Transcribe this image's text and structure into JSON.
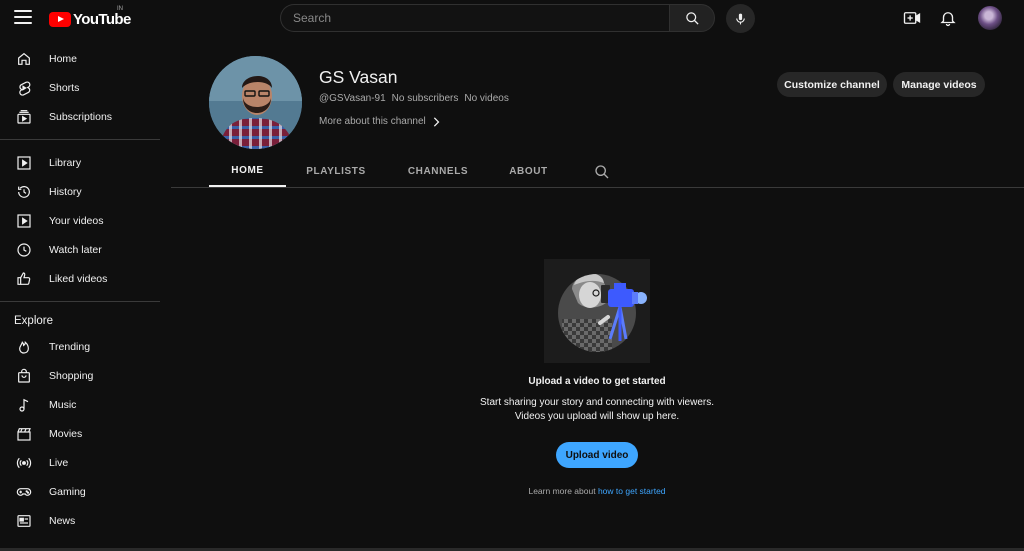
{
  "topbar": {
    "logo_text": "YouTube",
    "country_code": "IN",
    "search_placeholder": "Search",
    "icons": [
      "hamburger-icon",
      "search-icon",
      "microphone-icon",
      "create-video-icon",
      "bell-icon"
    ]
  },
  "sidebar": {
    "primary": [
      {
        "label": "Home",
        "icon": "home-icon"
      },
      {
        "label": "Shorts",
        "icon": "shorts-icon"
      },
      {
        "label": "Subscriptions",
        "icon": "subscriptions-icon"
      }
    ],
    "library": [
      {
        "label": "Library",
        "icon": "library-icon"
      },
      {
        "label": "History",
        "icon": "history-icon"
      },
      {
        "label": "Your videos",
        "icon": "your-videos-icon"
      },
      {
        "label": "Watch later",
        "icon": "watch-later-icon"
      },
      {
        "label": "Liked videos",
        "icon": "like-icon"
      }
    ],
    "explore_heading": "Explore",
    "explore": [
      {
        "label": "Trending",
        "icon": "trending-icon"
      },
      {
        "label": "Shopping",
        "icon": "shopping-bag-icon"
      },
      {
        "label": "Music",
        "icon": "music-note-icon"
      },
      {
        "label": "Movies",
        "icon": "movies-icon"
      },
      {
        "label": "Live",
        "icon": "live-icon"
      },
      {
        "label": "Gaming",
        "icon": "gaming-icon"
      },
      {
        "label": "News",
        "icon": "news-icon"
      }
    ]
  },
  "channel": {
    "name": "GS Vasan",
    "handle": "@GSVasan-91",
    "subscribers": "No subscribers",
    "videos": "No videos",
    "more_about": "More about this channel",
    "customize_label": "Customize channel",
    "manage_label": "Manage videos"
  },
  "tabs": [
    {
      "label": "HOME",
      "active": true
    },
    {
      "label": "PLAYLISTS",
      "active": false
    },
    {
      "label": "CHANNELS",
      "active": false
    },
    {
      "label": "ABOUT",
      "active": false
    }
  ],
  "empty_state": {
    "title": "Upload a video to get started",
    "body": "Start sharing your story and connecting with viewers. Videos you upload will show up here.",
    "upload_label": "Upload video",
    "learn_prefix": "Learn more about",
    "learn_link": "how to get started"
  },
  "colors": {
    "background": "#0f0f0f",
    "accent_blue": "#3ea6ff",
    "logo_red": "#ff0000",
    "pill_bg": "#272727"
  }
}
